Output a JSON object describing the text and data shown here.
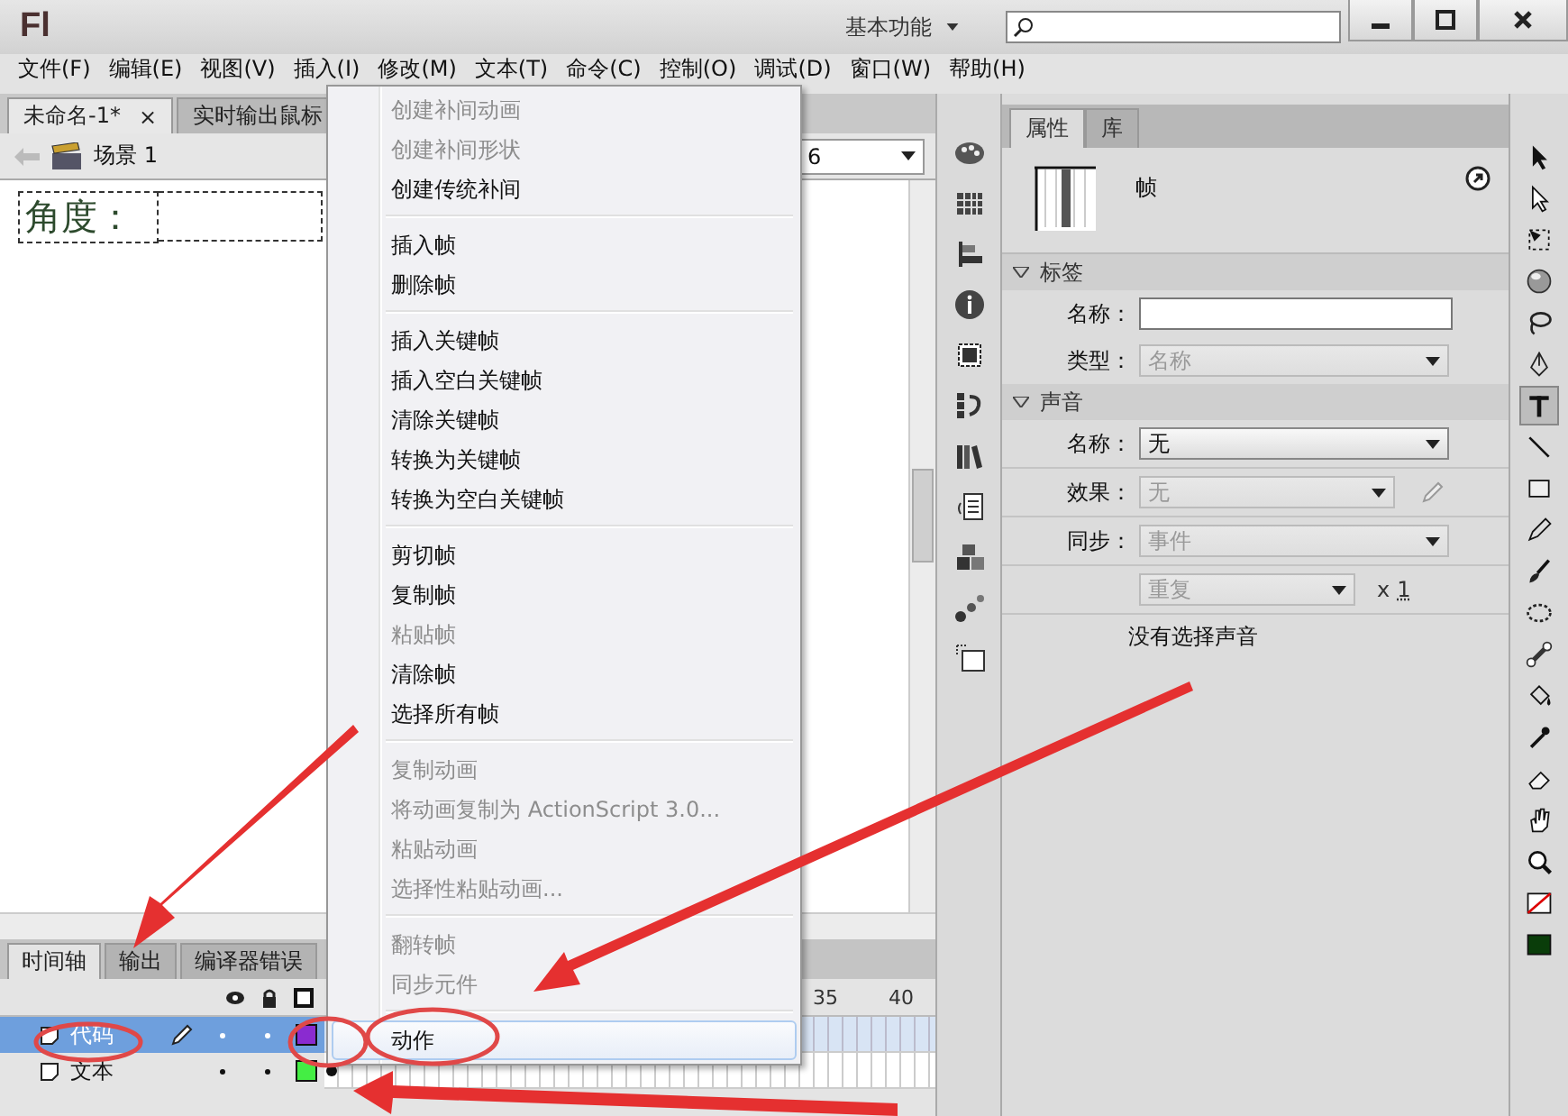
{
  "window": {
    "logo": "Fl",
    "workspace": "基本功能"
  },
  "menu_bar": [
    "文件(F)",
    "编辑(E)",
    "视图(V)",
    "插入(I)",
    "修改(M)",
    "文本(T)",
    "命令(C)",
    "控制(O)",
    "调试(D)",
    "窗口(W)",
    "帮助(H)"
  ],
  "document_tabs": [
    {
      "label": "未命名-1*",
      "close": "×",
      "selected": true
    },
    {
      "label": "实时输出鼠标",
      "selected": false
    }
  ],
  "edit_bar": {
    "scene": "场景 1",
    "zoom": "6"
  },
  "stage": {
    "text": "角度："
  },
  "context_menu": {
    "groups": [
      [
        {
          "label": "创建补间动画",
          "disabled": true,
          "selected": false
        },
        {
          "label": "创建补间形状",
          "disabled": true,
          "selected": false
        },
        {
          "label": "创建传统补间",
          "disabled": false,
          "selected": false
        }
      ],
      [
        {
          "label": "插入帧",
          "disabled": false,
          "selected": false
        },
        {
          "label": "删除帧",
          "disabled": false,
          "selected": false
        }
      ],
      [
        {
          "label": "插入关键帧",
          "disabled": false,
          "selected": false
        },
        {
          "label": "插入空白关键帧",
          "disabled": false,
          "selected": false
        },
        {
          "label": "清除关键帧",
          "disabled": false,
          "selected": false
        },
        {
          "label": "转换为关键帧",
          "disabled": false,
          "selected": false
        },
        {
          "label": "转换为空白关键帧",
          "disabled": false,
          "selected": false
        }
      ],
      [
        {
          "label": "剪切帧",
          "disabled": false,
          "selected": false
        },
        {
          "label": "复制帧",
          "disabled": false,
          "selected": false
        },
        {
          "label": "粘贴帧",
          "disabled": true,
          "selected": false
        },
        {
          "label": "清除帧",
          "disabled": false,
          "selected": false
        },
        {
          "label": "选择所有帧",
          "disabled": false,
          "selected": false
        }
      ],
      [
        {
          "label": "复制动画",
          "disabled": true,
          "selected": false
        },
        {
          "label": "将动画复制为 ActionScript 3.0...",
          "disabled": true,
          "selected": false
        },
        {
          "label": "粘贴动画",
          "disabled": true,
          "selected": false
        },
        {
          "label": "选择性粘贴动画...",
          "disabled": true,
          "selected": false
        }
      ],
      [
        {
          "label": "翻转帧",
          "disabled": true,
          "selected": false
        },
        {
          "label": "同步元件",
          "disabled": true,
          "selected": false
        }
      ],
      [
        {
          "label": "动作",
          "disabled": false,
          "selected": true
        }
      ]
    ]
  },
  "timeline": {
    "tabs": [
      {
        "label": "时间轴",
        "selected": true
      },
      {
        "label": "输出",
        "selected": false
      },
      {
        "label": "编译器错误",
        "selected": false
      }
    ],
    "frame_numbers": [
      "35",
      "40"
    ],
    "layers": [
      {
        "name": "代码",
        "selected": true,
        "editing": true,
        "color": "#8a2bd0"
      },
      {
        "name": "文本",
        "selected": false,
        "editing": false,
        "color": "#44ee44",
        "keyframe": true
      }
    ]
  },
  "properties_panel": {
    "tabs": [
      {
        "label": "属性",
        "selected": true
      },
      {
        "label": "库",
        "selected": false
      }
    ],
    "type": "帧",
    "sections": [
      {
        "title": "标签",
        "expanded": true,
        "rows": [
          {
            "kind": "input",
            "label": "名称："
          },
          {
            "kind": "dropdown",
            "label": "类型：",
            "value": "名称",
            "disabled": true
          }
        ]
      },
      {
        "title": "声音",
        "expanded": true,
        "rows": [
          {
            "kind": "dropdown",
            "label": "名称：",
            "value": "无",
            "disabled": false
          },
          {
            "kind": "dropdown",
            "label": "效果：",
            "value": "无",
            "disabled": true,
            "edit_button": true
          },
          {
            "kind": "dropdown",
            "label": "同步：",
            "value": "事件",
            "disabled": true
          },
          {
            "kind": "repeat",
            "value": "重复",
            "disabled": true,
            "times": "x",
            "count": "1"
          },
          {
            "kind": "note",
            "text": "没有选择声音"
          }
        ]
      }
    ]
  },
  "tools": [
    {
      "kind": "select",
      "selected": false
    },
    {
      "kind": "subselect",
      "selected": false
    },
    {
      "kind": "transform",
      "selected": false
    },
    {
      "kind": "sphere",
      "selected": false
    },
    {
      "kind": "lasso",
      "selected": false
    },
    {
      "kind": "pen",
      "selected": false
    },
    {
      "kind": "text",
      "selected": true
    },
    {
      "kind": "line",
      "selected": false
    },
    {
      "kind": "rect",
      "selected": false
    },
    {
      "kind": "pencil",
      "selected": false
    },
    {
      "kind": "brush",
      "selected": false
    },
    {
      "kind": "deco",
      "selected": false
    },
    {
      "kind": "bone",
      "selected": false
    },
    {
      "kind": "bucket",
      "selected": false
    },
    {
      "kind": "eyedropper",
      "selected": false
    },
    {
      "kind": "eraser",
      "selected": false
    },
    {
      "kind": "hand",
      "selected": false
    },
    {
      "kind": "zoom",
      "selected": false
    },
    {
      "kind": "stroke",
      "selected": false
    },
    {
      "kind": "fill",
      "selected": false
    }
  ]
}
